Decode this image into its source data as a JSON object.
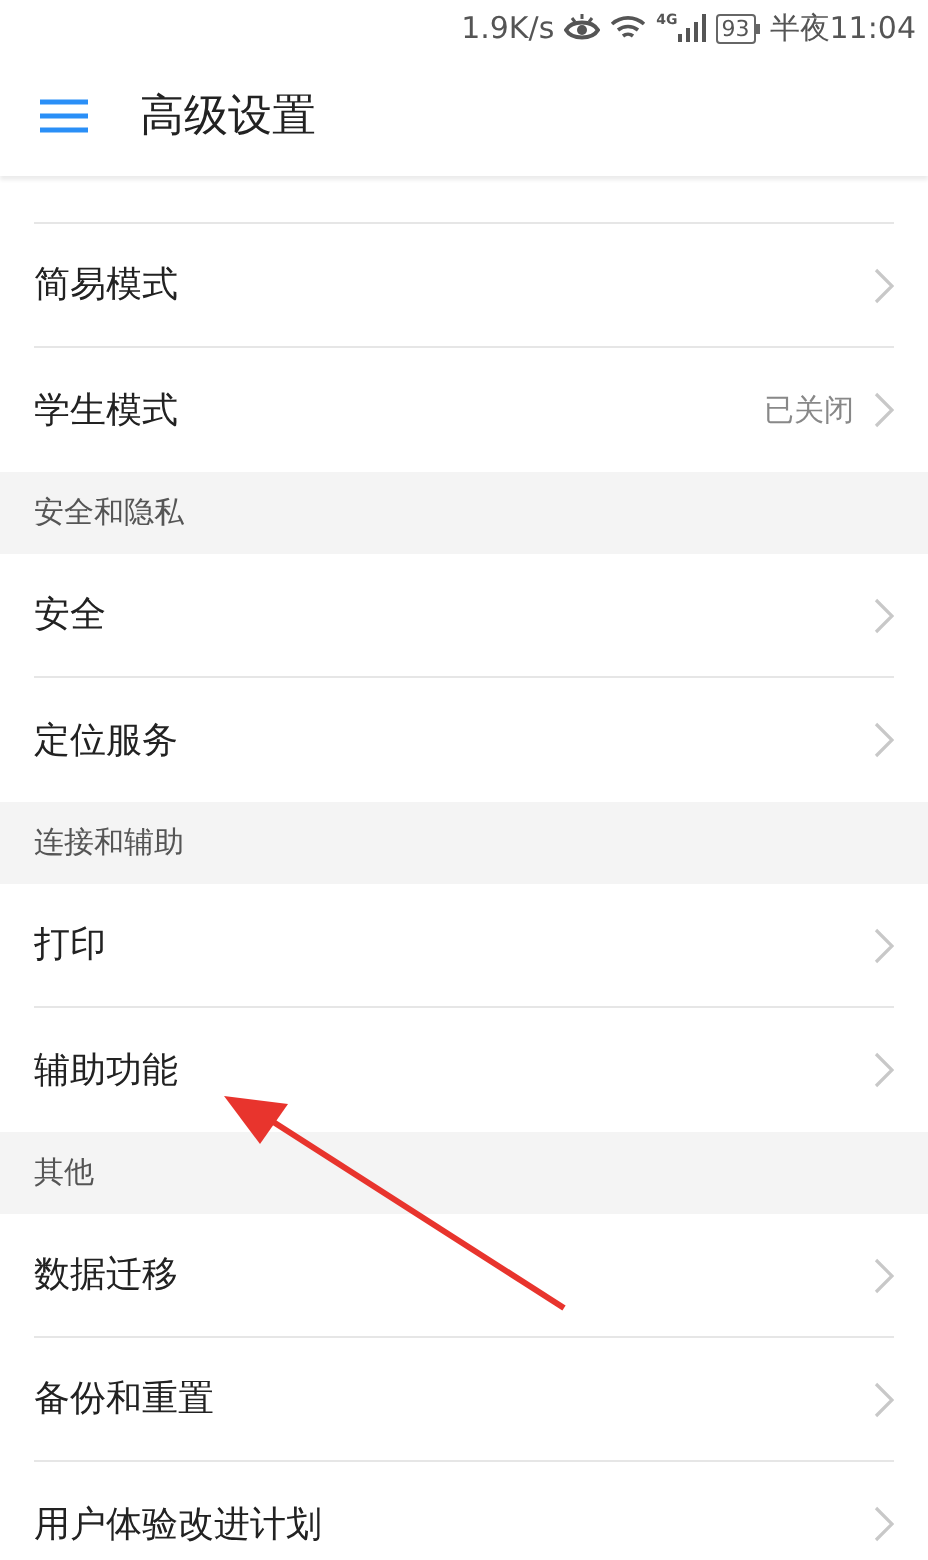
{
  "status_bar": {
    "speed": "1.9K/s",
    "network_type": "4G",
    "battery": "93",
    "time": "半夜11:04"
  },
  "header": {
    "title": "高级设置"
  },
  "sections": [
    {
      "items": [
        {
          "label": "简易模式"
        },
        {
          "label": "学生模式",
          "value": "已关闭"
        }
      ]
    },
    {
      "title": "安全和隐私",
      "items": [
        {
          "label": "安全"
        },
        {
          "label": "定位服务"
        }
      ]
    },
    {
      "title": "连接和辅助",
      "items": [
        {
          "label": "打印"
        },
        {
          "label": "辅助功能"
        }
      ]
    },
    {
      "title": "其他",
      "items": [
        {
          "label": "数据迁移"
        },
        {
          "label": "备份和重置"
        },
        {
          "label": "用户体验改进计划"
        }
      ]
    }
  ]
}
